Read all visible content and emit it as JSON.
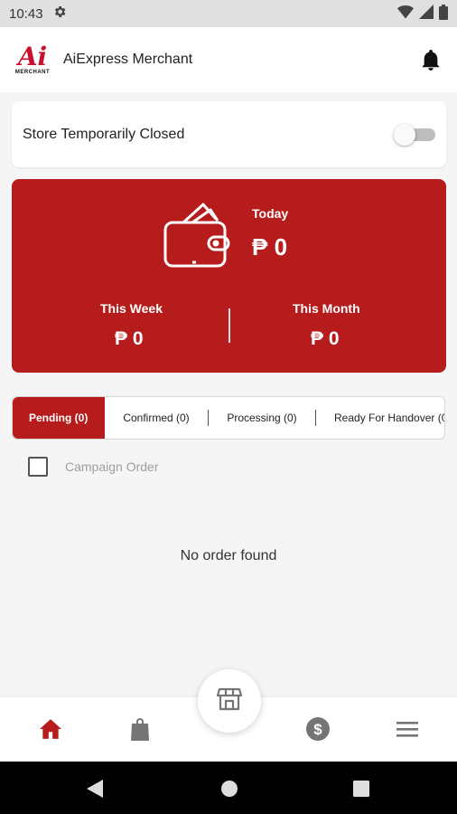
{
  "status_bar": {
    "time": "10:43",
    "icons": [
      "gear-icon",
      "wifi-icon",
      "signal-icon",
      "battery-icon"
    ]
  },
  "header": {
    "logo_mark": "Ai",
    "logo_sub": "MERCHANT",
    "title": "AiExpress Merchant",
    "notification_icon": "bell-icon"
  },
  "store": {
    "label": "Store Temporarily Closed",
    "toggle_on": false
  },
  "earnings": {
    "currency_symbol": "₱",
    "today_label": "Today",
    "today_value": "₱ 0",
    "week_label": "This Week",
    "week_value": "₱ 0",
    "month_label": "This Month",
    "month_value": "₱ 0"
  },
  "order_tabs": [
    {
      "label": "Pending (0)",
      "active": true
    },
    {
      "label": "Confirmed (0)",
      "active": false
    },
    {
      "label": "Processing (0)",
      "active": false
    },
    {
      "label": "Ready For Handover (0",
      "active": false
    }
  ],
  "filter": {
    "campaign_label": "Campaign Order",
    "checked": false
  },
  "empty_message": "No order found",
  "bottom_nav": {
    "items": [
      "home-icon",
      "shopping-bag-icon",
      "store-icon",
      "dollar-icon",
      "menu-icon"
    ],
    "active": "home-icon"
  },
  "colors": {
    "brand": "#b71c1c",
    "inactive_icon": "#757575"
  }
}
